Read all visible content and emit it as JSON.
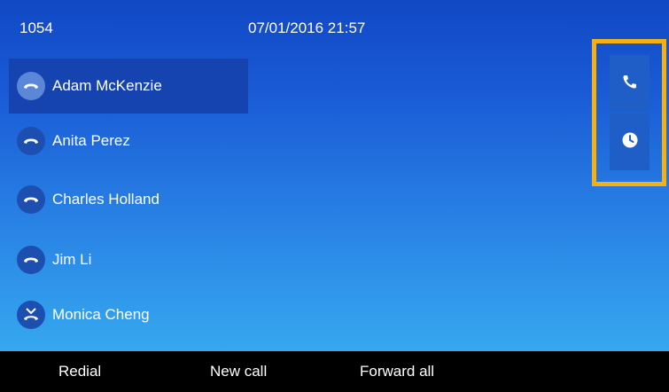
{
  "header": {
    "extension": "1054",
    "datetime": "07/01/2016 21:57"
  },
  "lines": [
    {
      "label": "Adam McKenzie",
      "icon": "handset-hangup-icon",
      "selected": true
    },
    {
      "label": "Anita Perez",
      "icon": "handset-hangup-icon",
      "selected": false
    },
    {
      "label": "Charles Holland",
      "icon": "handset-hangup-icon",
      "selected": false
    },
    {
      "label": "Jim Li",
      "icon": "handset-hangup-icon",
      "selected": false
    },
    {
      "label": "Monica Cheng",
      "icon": "missed-call-icon",
      "selected": false
    }
  ],
  "side_buttons": [
    {
      "icon": "phone-icon"
    },
    {
      "icon": "clock-icon"
    }
  ],
  "softkeys": [
    "Redial",
    "New call",
    "Forward all"
  ],
  "colors": {
    "highlight_border": "#f5b111",
    "selected_row": "#1544b0",
    "softkey_bar": "#000000"
  }
}
